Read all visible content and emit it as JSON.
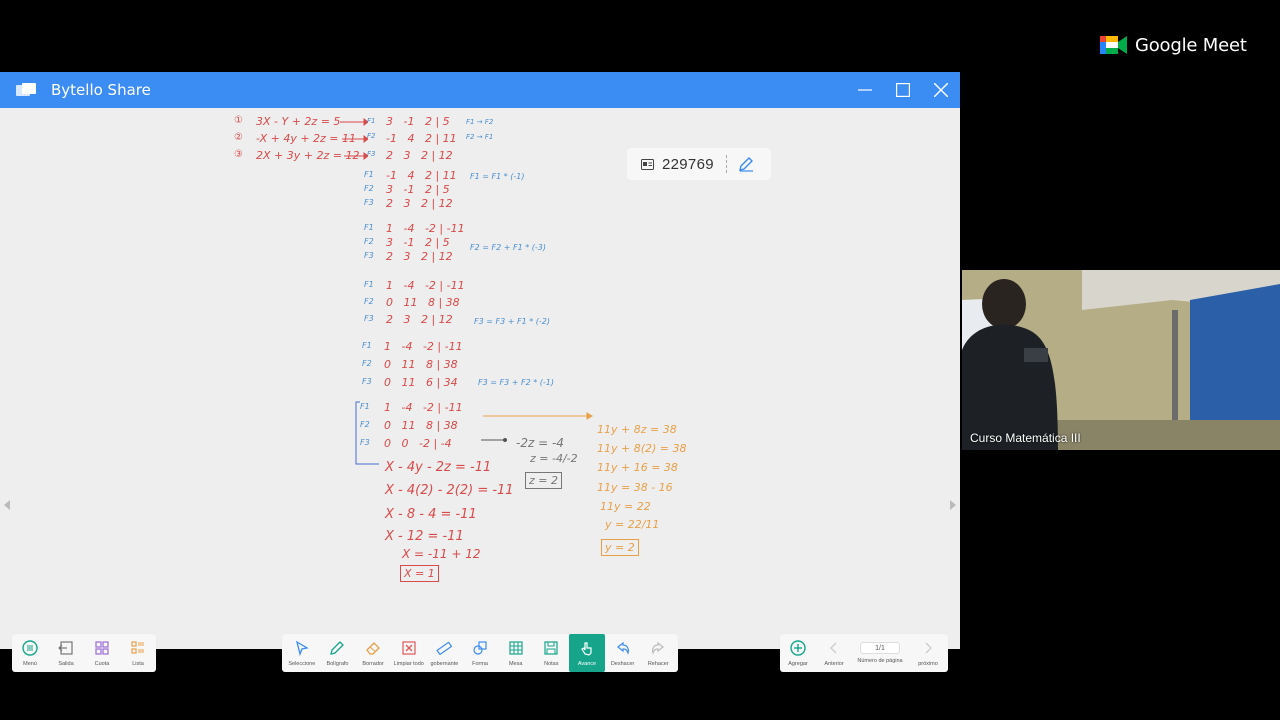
{
  "meet": {
    "brand": "Google Meet"
  },
  "window": {
    "title": "Bytello Share"
  },
  "session": {
    "code": "229769"
  },
  "board": {
    "system": [
      {
        "num": "①",
        "eq": "3X - Y + 2z = 5",
        "row": "F1",
        "m": "3   -1   2 | 5",
        "note": "F1 → F2"
      },
      {
        "num": "②",
        "eq": "-X + 4y + 2z = 11",
        "row": "F2",
        "m": "-1   4   2 | 11",
        "note": "F2 → F1"
      },
      {
        "num": "③",
        "eq": "2X + 3y + 2z = 12",
        "row": "F3",
        "m": "2   3   2 | 12",
        "note": ""
      }
    ],
    "m1": [
      "-1   4   2 | 11",
      "3   -1   2 | 5",
      "2   3   2 | 12"
    ],
    "m1_note": "F1 = F1 * (-1)",
    "m2": [
      "1   -4   -2 | -11",
      "3   -1   2 | 5",
      "2   3   2 | 12"
    ],
    "m2_note": "F2 = F2 + F1 * (-3)",
    "m3": [
      "1   -4   -2 | -11",
      "0   11   8 | 38",
      "2   3   2 | 12"
    ],
    "m3_note": "F3 = F3 + F1 * (-2)",
    "m4": [
      "1   -4   -2 | -11",
      "0   11   8 | 38",
      "0   11   6 | 34"
    ],
    "m4_note": "F3 = F3 + F2 * (-1)",
    "m5": [
      "1   -4   -2 | -11",
      "0   11   8 | 38",
      "0   0   -2 | -4"
    ],
    "rows": [
      "F1",
      "F2",
      "F3"
    ],
    "z_steps": [
      "-2z = -4",
      "z = -4/-2",
      "z = 2"
    ],
    "y_steps": [
      "11y + 8z = 38",
      "11y + 8(2) = 38",
      "11y + 16 = 38",
      "11y = 38 - 16",
      "11y = 22",
      "y = 22/11",
      "y = 2"
    ],
    "x_steps": [
      "X - 4y - 2z = -11",
      "X - 4(2) - 2(2) = -11",
      "X - 8 - 4 = -11",
      "X - 12 = -11",
      "X = -11 + 12",
      "X = 1"
    ]
  },
  "toolbar_left": [
    {
      "label": "Menú",
      "icon": "menu-icon"
    },
    {
      "label": "Salida",
      "icon": "exit-icon"
    },
    {
      "label": "Cuota",
      "icon": "share-icon"
    },
    {
      "label": "Lista",
      "icon": "list-icon"
    }
  ],
  "toolbar_main": [
    {
      "label": "Seleccione",
      "icon": "select-icon"
    },
    {
      "label": "Bolígrafo",
      "icon": "pen-icon"
    },
    {
      "label": "Borrador",
      "icon": "eraser-icon"
    },
    {
      "label": "Limpiar todo",
      "icon": "clear-icon"
    },
    {
      "label": "gobernante",
      "icon": "ruler-icon"
    },
    {
      "label": "Forma",
      "icon": "shape-icon"
    },
    {
      "label": "Mesa",
      "icon": "table-icon"
    },
    {
      "label": "Notas",
      "icon": "notes-icon"
    },
    {
      "label": "Avance",
      "icon": "pointer-icon"
    },
    {
      "label": "Deshacer",
      "icon": "undo-icon"
    },
    {
      "label": "Rehacer",
      "icon": "redo-icon"
    }
  ],
  "toolbar_right": {
    "add": "Agregar",
    "prev": "Anterior",
    "page_label": "Número de página",
    "page": "1/1",
    "next": "próximo"
  },
  "camera": {
    "participant": "Curso Matemática III"
  },
  "colors": {
    "accent": "#3b8cf3",
    "active": "#16a58b"
  }
}
